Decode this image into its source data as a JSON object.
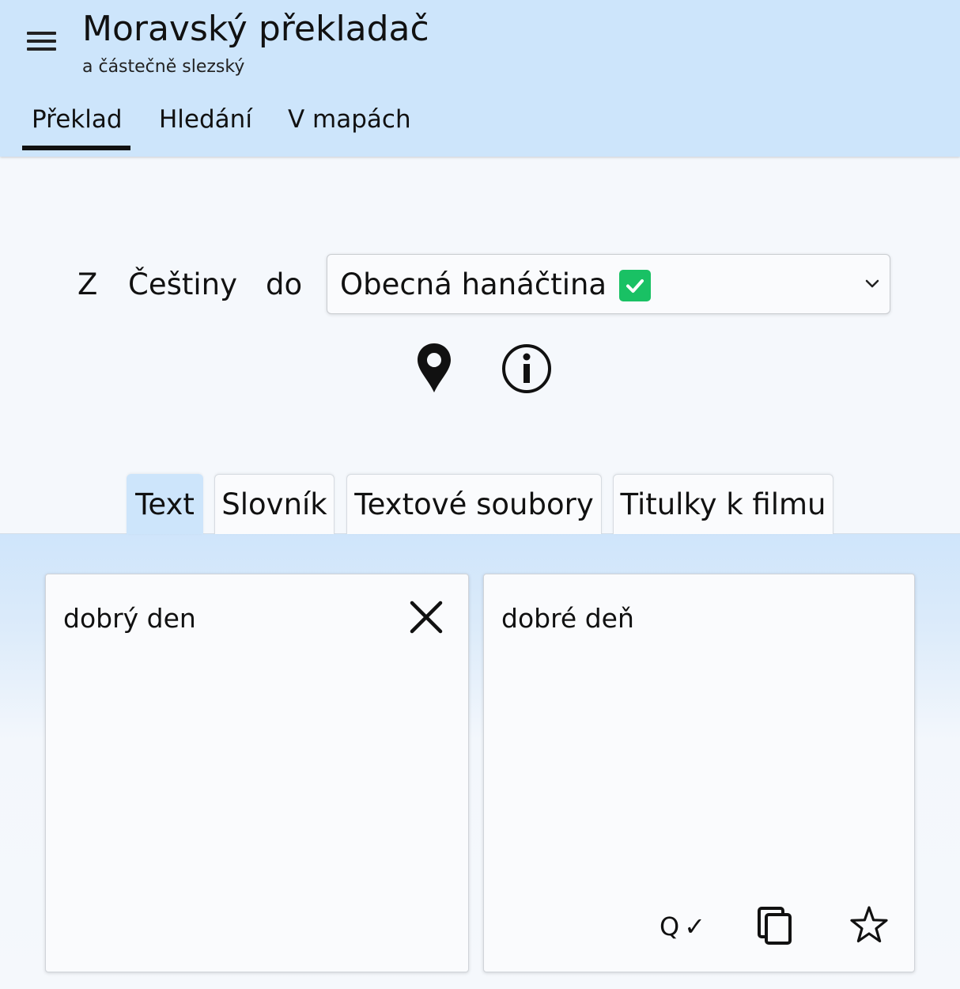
{
  "header": {
    "title": "Moravský překladač",
    "subtitle": "a částečně slezský",
    "menu_icon": "hamburger-menu-icon",
    "tabs": [
      {
        "label": "Překlad",
        "active": true
      },
      {
        "label": "Hledání",
        "active": false
      },
      {
        "label": "V mapách",
        "active": false
      }
    ]
  },
  "language": {
    "from_prefix": "Z",
    "from_language": "Češtiny",
    "to_prefix": "do",
    "target_select": {
      "value": "Obecná hanáčtina",
      "verified_icon": "green-check-icon",
      "dropdown_icon": "chevron-down-icon"
    },
    "actions": [
      {
        "icon": "map-pin-icon"
      },
      {
        "icon": "info-circle-icon"
      }
    ]
  },
  "panel_tabs": [
    {
      "label": "Text",
      "active": true
    },
    {
      "label": "Slovník",
      "active": false
    },
    {
      "label": "Textové soubory",
      "active": false
    },
    {
      "label": "Titulky k filmu",
      "active": false
    }
  ],
  "input_panel": {
    "text": "dobrý den",
    "clear_icon": "close-icon"
  },
  "output_panel": {
    "text": "dobré deň",
    "quality_label": "Q",
    "quality_check": "✓",
    "copy_icon": "copy-icon",
    "favorite_icon": "star-icon"
  },
  "colors": {
    "header_bg": "#cde5fb",
    "page_bg": "#f5f8fc",
    "accent_green": "#19c164",
    "active_tab_underline": "#111111"
  }
}
